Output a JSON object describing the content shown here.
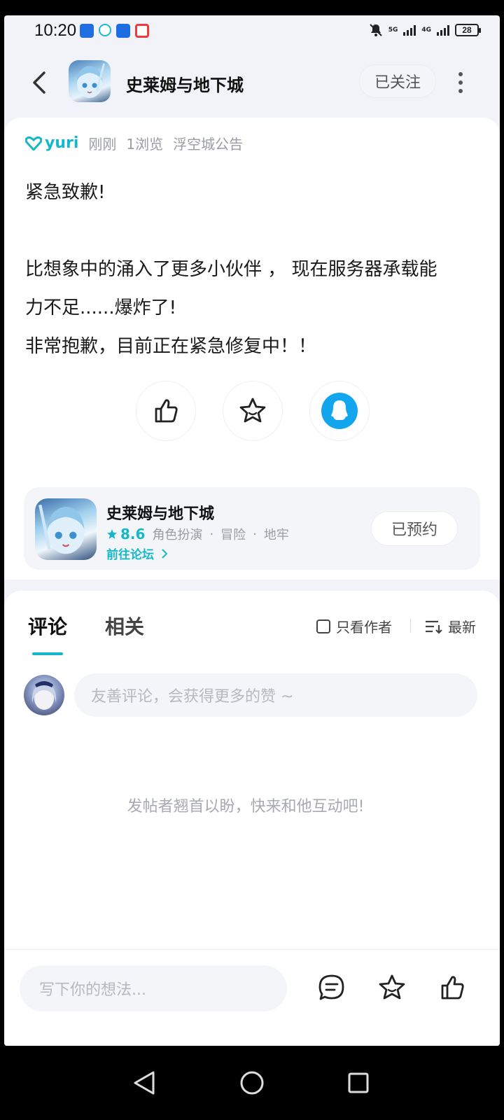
{
  "status_bar": {
    "time": "10:20",
    "network_1": "5G",
    "network_2": "4G",
    "battery": "28"
  },
  "header": {
    "title": "史莱姆与地下城",
    "follow_label": "已关注"
  },
  "post": {
    "author": "yuri",
    "time": "刚刚",
    "views": "1浏览",
    "category": "浮空城公告",
    "lines": [
      "紧急致歉!",
      "",
      "比想象中的涌入了更多小伙伴 ， 现在服务器承载能",
      "力不足......爆炸了!",
      "非常抱歉，目前正在紧急修复中！！"
    ]
  },
  "game_card": {
    "name": "史莱姆与地下城",
    "rating": "8.6",
    "tags": [
      "角色扮演",
      "冒险",
      "地牢"
    ],
    "forum_link": "前往论坛",
    "reserve_label": "已预约"
  },
  "comments": {
    "tab_comment": "评论",
    "tab_related": "相关",
    "author_only_label": "只看作者",
    "sort_label": "最新",
    "input_placeholder": "友善评论，会获得更多的赞 ~",
    "empty_hint": "发帖者翘首以盼，快来和他互动吧!"
  },
  "bottom_bar": {
    "input_placeholder": "写下你的想法..."
  },
  "colors": {
    "accent": "#15b8c8",
    "qq_blue": "#12a6ee"
  }
}
